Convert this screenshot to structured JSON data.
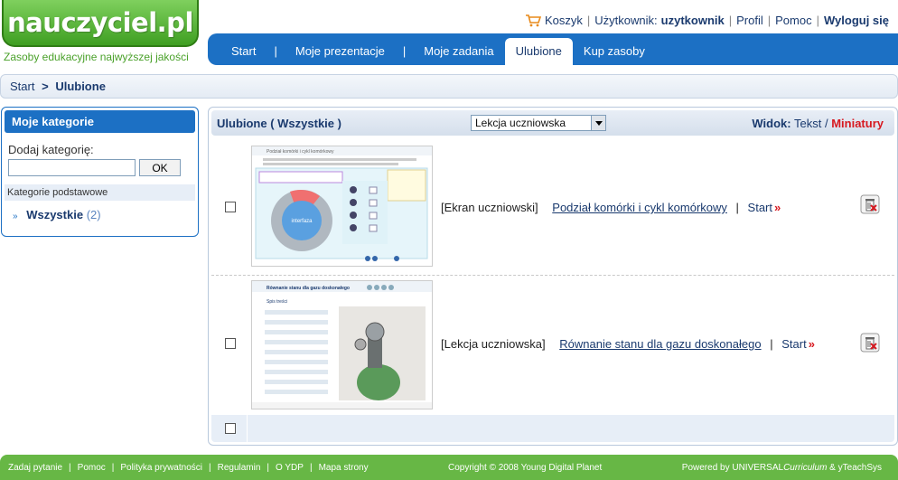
{
  "logo": {
    "text": "nauczyciel.pl",
    "tagline": "Zasoby edukacyjne najwyższej jakości"
  },
  "user_bar": {
    "cart": "Koszyk",
    "user_label": "Użytkownik:",
    "username": "uzytkownik",
    "profile": "Profil",
    "help": "Pomoc",
    "logout": "Wyloguj się"
  },
  "nav": {
    "start": "Start",
    "presentations": "Moje prezentacje",
    "tasks": "Moje zadania",
    "favorites": "Ulubione",
    "buy": "Kup zasoby",
    "separator": "|"
  },
  "breadcrumb": {
    "home": "Start",
    "arrow": ">",
    "current": "Ulubione"
  },
  "sidebar": {
    "title": "Moje kategorie",
    "add_label": "Dodaj kategorię:",
    "add_value": "",
    "ok": "OK",
    "section": "Kategorie podstawowe",
    "items": [
      {
        "name": "Wszystkie",
        "count": "(2)"
      }
    ]
  },
  "main": {
    "title": "Ulubione ( Wszystkie )",
    "filter_value": "Lekcja uczniowska",
    "view_label": "Widok:",
    "view_text": "Tekst",
    "view_sep": "/",
    "view_thumbs": "Miniatury",
    "items": [
      {
        "type": "[Ekran uczniowski]",
        "title": "Podział komórki i cykl komórkowy",
        "start": "Start",
        "thumb_title": "Podział komórki i cykl komórkowy",
        "thumb_center": "interfaza"
      },
      {
        "type": "[Lekcja uczniowska]",
        "title": "Równanie stanu dla gazu doskonałego",
        "start": "Start",
        "thumb_title": "Równanie stanu dla gazu doskonałego",
        "thumb_toc": "Spis treści"
      }
    ]
  },
  "footer": {
    "links": [
      "Zadaj pytanie",
      "Pomoc",
      "Polityka prywatności",
      "Regulamin",
      "O YDP",
      "Mapa strony"
    ],
    "copyright": "Copyright © 2008 Young Digital Planet",
    "powered_prefix": "Powered by UNIVERSAL",
    "powered_italic": "Curriculum",
    "powered_suffix": " & yTeachSys"
  },
  "colors": {
    "brand_green": "#4aa12a",
    "nav_blue": "#1c70c4",
    "accent_red": "#d71920"
  }
}
